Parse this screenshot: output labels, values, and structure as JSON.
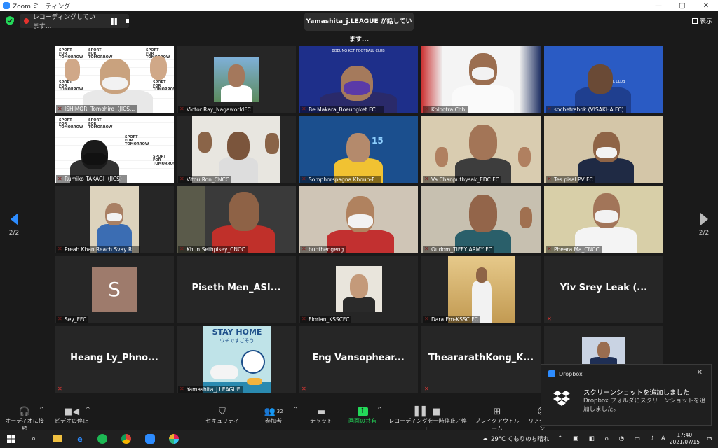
{
  "window": {
    "title": "Zoom ミーティング"
  },
  "topbar": {
    "recording_label": "レコーディングしています...",
    "talking": "Yamashita_j.LEAGUE が話しています...",
    "view_label": "表示"
  },
  "pager": {
    "page": "2/2"
  },
  "participants": [
    {
      "name": "ISHIMORI Tomohiro（JICS..."
    },
    {
      "name": "Victor Ray_NagaworldFC"
    },
    {
      "name": "Be Makara_Boeungket FC ..."
    },
    {
      "name": "Kolbotra Chhi"
    },
    {
      "name": "sochetrahok (VISAKHA FC)"
    },
    {
      "name": "Rumiko TAKAGI（JICS）"
    },
    {
      "name": "Vitou Ron_CNCC"
    },
    {
      "name": "Somphorspagna Khoun-F..."
    },
    {
      "name": "Va Chanputhysak_EDC FC"
    },
    {
      "name": "Tes pisal PV FC"
    },
    {
      "name": "Preah Khan Reach Svay Ri..."
    },
    {
      "name": "Khun Sethpisey_CNCC"
    },
    {
      "name": "bunthengeng"
    },
    {
      "name": "Oudom_TIFFY ARMY FC"
    },
    {
      "name": "Pheara Ma_CNCC"
    },
    {
      "name": "Sey_FFC",
      "initial": "S"
    },
    {
      "name": "",
      "big": "Piseth  Men_ASI..."
    },
    {
      "name": "Florian_KSSCFC"
    },
    {
      "name": "Dara Em-KSSC FC"
    },
    {
      "name": "",
      "big": "Yiv Srey Leak (..."
    },
    {
      "name": "",
      "big": "Heang  Ly_Phno..."
    },
    {
      "name": "Yamashita_j.LEAGUE",
      "poster_line1": "STAY HOME",
      "poster_line2": "ウチですごそう"
    },
    {
      "name": "",
      "big": "Eng  Vansophear..."
    },
    {
      "name": "",
      "big": "TheararathKong_K..."
    },
    {
      "name": ""
    }
  ],
  "logos": {
    "sport_line1": "SPORT",
    "sport_line2": "FOR",
    "sport_line3": "TOMORROW",
    "boeungket_banner": "BOEUNG KET FOOTBALL CLUB",
    "visakha_banner": "FOOTBALL CLUB"
  },
  "toolbar": {
    "audio": "オーディオに接続",
    "video": "ビデオの停止",
    "security": "セキュリティ",
    "participants": "参加者",
    "participants_count": "32",
    "chat": "チャット",
    "share": "画面の共有",
    "pause_rec": "レコーディングを一時停止／停止",
    "breakout": "ブレイクアウトルーム",
    "reaction": "リアクション"
  },
  "toast": {
    "app": "Dropbox",
    "title": "スクリーンショットを追加しました",
    "message": "Dropbox フォルダにスクリーンショットを追加しました。"
  },
  "taskbar": {
    "weather": "29°C くもりのち晴れ",
    "ime": "A",
    "time": "17:40",
    "date": "2021/07/15",
    "notifications": "5"
  },
  "colors": {
    "accent": "#2d8cff",
    "share_green": "#23d959",
    "mic_red": "#e53935",
    "rec_red": "#e5322d"
  }
}
